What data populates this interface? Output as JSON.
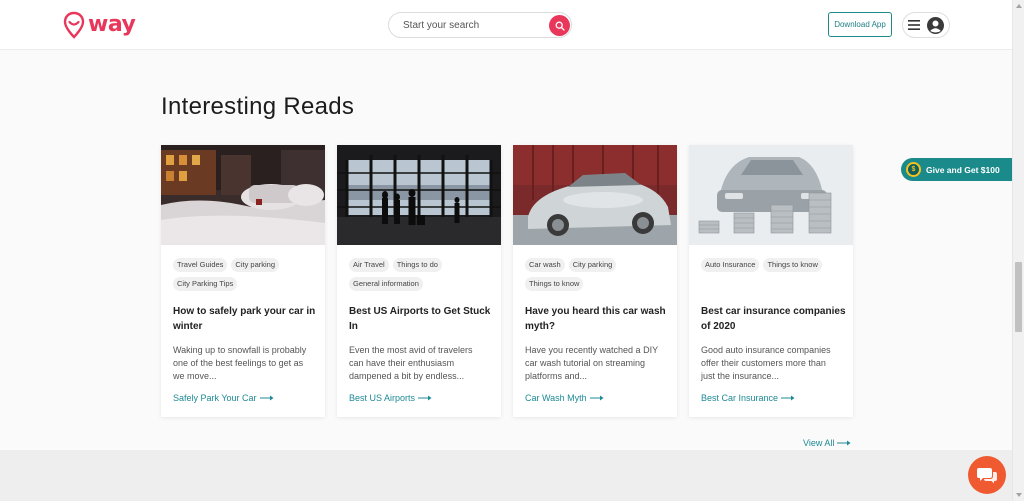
{
  "header": {
    "logo_text": "way",
    "search_placeholder": "Start your search",
    "download_label": "Download App"
  },
  "section": {
    "title": "Interesting Reads",
    "view_all": "View All"
  },
  "cards": [
    {
      "tags": [
        "Travel Guides",
        "City parking",
        "City Parking Tips"
      ],
      "title": "How to safely park your car in winter",
      "excerpt": "Waking up to snowfall is probably one of the best feelings to get as we move...",
      "link": "Safely Park Your Car"
    },
    {
      "tags": [
        "Air Travel",
        "Things to do",
        "General information"
      ],
      "title": "Best US Airports to Get Stuck In",
      "excerpt": "Even the most avid of travelers can have their enthusiasm dampened a bit by endless...",
      "link": "Best US Airports"
    },
    {
      "tags": [
        "Car wash",
        "City parking",
        "Things to know"
      ],
      "title": "Have you heard this car wash myth?",
      "excerpt": "Have you recently watched a DIY car wash tutorial on streaming platforms and...",
      "link": "Car Wash Myth"
    },
    {
      "tags": [
        "Auto Insurance",
        "Things to know"
      ],
      "title": "Best car insurance companies of 2020",
      "excerpt": "Good auto insurance companies offer their customers more than just the insurance...",
      "link": "Best Car Insurance"
    }
  ],
  "promo": {
    "give_label": "Give and Get $100"
  },
  "colors": {
    "brand": "#e8375a",
    "teal": "#1e8a96",
    "chat": "#ef5a30"
  }
}
